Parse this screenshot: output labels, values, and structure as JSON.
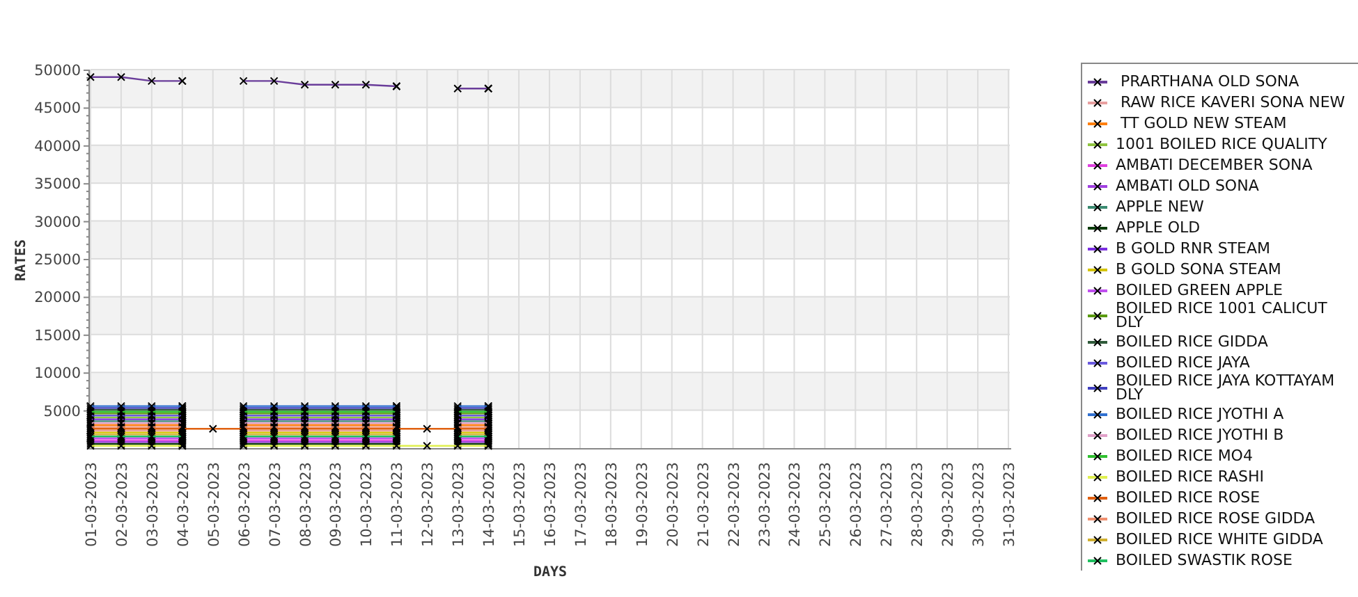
{
  "chart": {
    "chart_data": {
      "type": "line",
      "grid": true,
      "xlabel": "DAYS",
      "ylabel": "RATES",
      "categories": [
        "01-03-2023",
        "02-03-2023",
        "03-03-2023",
        "04-03-2023",
        "05-03-2023",
        "06-03-2023",
        "07-03-2023",
        "08-03-2023",
        "09-03-2023",
        "10-03-2023",
        "11-03-2023",
        "12-03-2023",
        "13-03-2023",
        "14-03-2023",
        "15-03-2023",
        "16-03-2023",
        "17-03-2023",
        "18-03-2023",
        "19-03-2023",
        "20-03-2023",
        "21-03-2023",
        "22-03-2023",
        "23-03-2023",
        "24-03-2023",
        "25-03-2023",
        "26-03-2023",
        "27-03-2023",
        "28-03-2023",
        "29-03-2023",
        "30-03-2023",
        "31-03-2023"
      ],
      "ylim": [
        0,
        50000
      ],
      "yticks": [
        5000,
        10000,
        15000,
        20000,
        25000,
        30000,
        35000,
        40000,
        45000,
        50000
      ],
      "series": [
        {
          "name": " PRARTHANA OLD SONA",
          "color": "#6a3d9a",
          "values": [
            49000,
            49000,
            48500,
            48500,
            null,
            48500,
            48500,
            48000,
            48000,
            48000,
            47800,
            null,
            47500,
            47500,
            null,
            null,
            null,
            null,
            null,
            null,
            null,
            null,
            null,
            null,
            null,
            null,
            null,
            null,
            null,
            null,
            null
          ]
        },
        {
          "name": " RAW RICE KAVERI SONA NEW",
          "color": "#e8a0a0",
          "values": [
            2300,
            2300,
            2300,
            2300,
            null,
            2300,
            2300,
            2300,
            2300,
            2300,
            2300,
            null,
            2300,
            2300,
            null,
            null,
            null,
            null,
            null,
            null,
            null,
            null,
            null,
            null,
            null,
            null,
            null,
            null,
            null,
            null,
            null
          ]
        },
        {
          "name": " TT GOLD NEW STEAM",
          "color": "#ff7f0e",
          "values": [
            3050,
            3050,
            3050,
            3050,
            null,
            3050,
            3050,
            3050,
            3050,
            3050,
            3050,
            null,
            3050,
            3050,
            null,
            null,
            null,
            null,
            null,
            null,
            null,
            null,
            null,
            null,
            null,
            null,
            null,
            null,
            null,
            null,
            null
          ]
        },
        {
          "name": "1001 BOILED RICE QUALITY",
          "color": "#8fc43f",
          "values": [
            4050,
            4050,
            4050,
            4050,
            null,
            4050,
            4050,
            4050,
            4050,
            4050,
            4050,
            null,
            4050,
            4050,
            null,
            null,
            null,
            null,
            null,
            null,
            null,
            null,
            null,
            null,
            null,
            null,
            null,
            null,
            null,
            null,
            null
          ]
        },
        {
          "name": "AMBATI DECEMBER SONA",
          "color": "#e040e0",
          "values": [
            1050,
            1050,
            1050,
            1050,
            null,
            1050,
            1050,
            1050,
            1050,
            1050,
            1050,
            null,
            1050,
            1050,
            null,
            null,
            null,
            null,
            null,
            null,
            null,
            null,
            null,
            null,
            null,
            null,
            null,
            null,
            null,
            null,
            null
          ]
        },
        {
          "name": "AMBATI OLD SONA",
          "color": "#a040e0",
          "values": [
            800,
            800,
            800,
            800,
            null,
            800,
            800,
            800,
            800,
            800,
            800,
            null,
            800,
            800,
            null,
            null,
            null,
            null,
            null,
            null,
            null,
            null,
            null,
            null,
            null,
            null,
            null,
            null,
            null,
            null,
            null
          ]
        },
        {
          "name": "APPLE NEW",
          "color": "#3a8a70",
          "values": [
            3550,
            3550,
            3550,
            3550,
            null,
            3550,
            3550,
            3550,
            3550,
            3550,
            3550,
            null,
            3550,
            3550,
            null,
            null,
            null,
            null,
            null,
            null,
            null,
            null,
            null,
            null,
            null,
            null,
            null,
            null,
            null,
            null,
            null
          ]
        },
        {
          "name": "APPLE OLD",
          "color": "#0b3d0b",
          "values": [
            550,
            550,
            550,
            550,
            null,
            550,
            550,
            550,
            550,
            550,
            550,
            null,
            550,
            550,
            null,
            null,
            null,
            null,
            null,
            null,
            null,
            null,
            null,
            null,
            null,
            null,
            null,
            null,
            null,
            null,
            null
          ]
        },
        {
          "name": "B GOLD RNR STEAM",
          "color": "#7b2fe0",
          "values": [
            3800,
            3800,
            3800,
            3800,
            null,
            3800,
            3800,
            3800,
            3800,
            3800,
            3800,
            null,
            3800,
            3800,
            null,
            null,
            null,
            null,
            null,
            null,
            null,
            null,
            null,
            null,
            null,
            null,
            null,
            null,
            null,
            null,
            null
          ]
        },
        {
          "name": "B GOLD SONA STEAM",
          "color": "#d4c400",
          "values": [
            2050,
            2050,
            2050,
            2050,
            null,
            2050,
            2050,
            2050,
            2050,
            2050,
            2050,
            null,
            2050,
            2050,
            null,
            null,
            null,
            null,
            null,
            null,
            null,
            null,
            null,
            null,
            null,
            null,
            null,
            null,
            null,
            null,
            null
          ]
        },
        {
          "name": "BOILED GREEN APPLE",
          "color": "#c050f0",
          "values": [
            1300,
            1300,
            1300,
            1300,
            null,
            1300,
            1300,
            1300,
            1300,
            1300,
            1300,
            null,
            1300,
            1300,
            null,
            null,
            null,
            null,
            null,
            null,
            null,
            null,
            null,
            null,
            null,
            null,
            null,
            null,
            null,
            null,
            null
          ]
        },
        {
          "name": "BOILED RICE 1001 CALICUT DLY",
          "color": "#5a9a10",
          "values": [
            4550,
            4550,
            4550,
            4550,
            null,
            4550,
            4550,
            4550,
            4550,
            4550,
            4550,
            null,
            4550,
            4550,
            null,
            null,
            null,
            null,
            null,
            null,
            null,
            null,
            null,
            null,
            null,
            null,
            null,
            null,
            null,
            null,
            null
          ]
        },
        {
          "name": "BOILED RICE GIDDA",
          "color": "#2f5a3a",
          "values": [
            5050,
            5050,
            5050,
            5050,
            null,
            5050,
            5050,
            5050,
            5050,
            5050,
            5050,
            null,
            5050,
            5050,
            null,
            null,
            null,
            null,
            null,
            null,
            null,
            null,
            null,
            null,
            null,
            null,
            null,
            null,
            null,
            null,
            null
          ]
        },
        {
          "name": "BOILED RICE JAYA",
          "color": "#6a5adf",
          "values": [
            4300,
            4300,
            4300,
            4300,
            null,
            4300,
            4300,
            4300,
            4300,
            4300,
            4300,
            null,
            4300,
            4300,
            null,
            null,
            null,
            null,
            null,
            null,
            null,
            null,
            null,
            null,
            null,
            null,
            null,
            null,
            null,
            null,
            null
          ]
        },
        {
          "name": "BOILED RICE JAYA KOTTAYAM DLY",
          "color": "#4040c0",
          "values": [
            5300,
            5300,
            5300,
            5300,
            null,
            5300,
            5300,
            5300,
            5300,
            5300,
            5300,
            null,
            5300,
            5300,
            null,
            null,
            null,
            null,
            null,
            null,
            null,
            null,
            null,
            null,
            null,
            null,
            null,
            null,
            null,
            null,
            null
          ]
        },
        {
          "name": "BOILED RICE JYOTHI A",
          "color": "#3070d0",
          "values": [
            5550,
            5550,
            5550,
            5550,
            null,
            5550,
            5550,
            5550,
            5550,
            5550,
            5550,
            null,
            5550,
            5550,
            null,
            null,
            null,
            null,
            null,
            null,
            null,
            null,
            null,
            null,
            null,
            null,
            null,
            null,
            null,
            null,
            null
          ]
        },
        {
          "name": "BOILED RICE JYOTHI B",
          "color": "#e0a0c8",
          "values": [
            3300,
            3300,
            3300,
            3300,
            null,
            3300,
            3300,
            3300,
            3300,
            3300,
            3300,
            null,
            3300,
            3300,
            null,
            null,
            null,
            null,
            null,
            null,
            null,
            null,
            null,
            null,
            null,
            null,
            null,
            null,
            null,
            null,
            null
          ]
        },
        {
          "name": "BOILED RICE MO4",
          "color": "#30c030",
          "values": [
            4800,
            4800,
            4800,
            4800,
            null,
            4800,
            4800,
            4800,
            4800,
            4800,
            4800,
            null,
            4800,
            4800,
            null,
            null,
            null,
            null,
            null,
            null,
            null,
            null,
            null,
            null,
            null,
            null,
            null,
            null,
            null,
            null,
            null
          ]
        },
        {
          "name": "BOILED RICE RASHI",
          "color": "#e0f050",
          "values": [
            300,
            300,
            300,
            300,
            null,
            300,
            300,
            300,
            300,
            300,
            300,
            300,
            300,
            300,
            null,
            null,
            null,
            null,
            null,
            null,
            null,
            null,
            null,
            null,
            null,
            null,
            null,
            null,
            null,
            null,
            null
          ]
        },
        {
          "name": "BOILED RICE ROSE",
          "color": "#e06010",
          "values": [
            2550,
            2550,
            2550,
            2550,
            2550,
            2550,
            2550,
            2550,
            2550,
            2550,
            2550,
            2550,
            2550,
            2550,
            null,
            null,
            null,
            null,
            null,
            null,
            null,
            null,
            null,
            null,
            null,
            null,
            null,
            null,
            null,
            null,
            null
          ]
        },
        {
          "name": "BOILED RICE ROSE GIDDA",
          "color": "#f09070",
          "values": [
            2800,
            2800,
            2800,
            2800,
            null,
            2800,
            2800,
            2800,
            2800,
            2800,
            2800,
            null,
            2800,
            2800,
            null,
            null,
            null,
            null,
            null,
            null,
            null,
            null,
            null,
            null,
            null,
            null,
            null,
            null,
            null,
            null,
            null
          ]
        },
        {
          "name": "BOILED RICE WHITE GIDDA",
          "color": "#d0b030",
          "values": [
            1800,
            1800,
            1800,
            1800,
            null,
            1800,
            1800,
            1800,
            1800,
            1800,
            1800,
            null,
            1800,
            1800,
            null,
            null,
            null,
            null,
            null,
            null,
            null,
            null,
            null,
            null,
            null,
            null,
            null,
            null,
            null,
            null,
            null
          ]
        },
        {
          "name": "BOILED SWASTIK ROSE",
          "color": "#20c060",
          "values": [
            1550,
            1550,
            1550,
            1550,
            null,
            1550,
            1550,
            1550,
            1550,
            1550,
            1550,
            null,
            1550,
            1550,
            null,
            null,
            null,
            null,
            null,
            null,
            null,
            null,
            null,
            null,
            null,
            null,
            null,
            null,
            null,
            null,
            null
          ]
        }
      ]
    }
  }
}
